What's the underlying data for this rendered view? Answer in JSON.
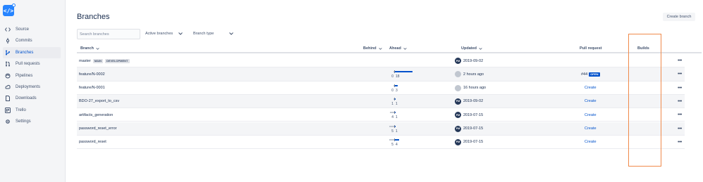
{
  "sidebar": {
    "logo": "</>",
    "items": [
      {
        "label": "Source",
        "icon": "code-icon"
      },
      {
        "label": "Commits",
        "icon": "commit-icon"
      },
      {
        "label": "Branches",
        "icon": "branch-icon"
      },
      {
        "label": "Pull requests",
        "icon": "pull-request-icon"
      },
      {
        "label": "Pipelines",
        "icon": "pipelines-icon"
      },
      {
        "label": "Deployments",
        "icon": "deployments-icon"
      },
      {
        "label": "Downloads",
        "icon": "downloads-icon"
      },
      {
        "label": "Trello",
        "icon": "trello-icon"
      },
      {
        "label": "Settings",
        "icon": "gear-icon"
      }
    ]
  },
  "header": {
    "title": "Branches",
    "create_button": "Create branch"
  },
  "filters": {
    "search_placeholder": "Search branches",
    "active": "Active branches",
    "type": "Branch type"
  },
  "table": {
    "columns": {
      "branch": "Branch",
      "behind": "Behind",
      "ahead": "Ahead",
      "updated": "Updated",
      "pull_request": "Pull request",
      "builds": "Builds"
    },
    "rows": [
      {
        "name": "master",
        "tags": [
          "MAIN",
          "DEVELOPMENT"
        ],
        "behind": null,
        "ahead": null,
        "behind_label": "",
        "ahead_label": "",
        "avatar": "PM",
        "avatar_default": false,
        "updated": "2019-09-02",
        "pr": ""
      },
      {
        "name": "feature/N-0002",
        "tags": [],
        "behind": 0,
        "ahead": 18,
        "behind_label": "0",
        "ahead_label": "18",
        "avatar": "",
        "avatar_default": true,
        "updated": "2 hours ago",
        "pr": "#44",
        "pr_status": "OPEN"
      },
      {
        "name": "feature/N-0001",
        "tags": [],
        "behind": 0,
        "ahead": 3,
        "behind_label": "0",
        "ahead_label": "3",
        "avatar": "",
        "avatar_default": true,
        "updated": "16 hours ago",
        "pr": "Create"
      },
      {
        "name": "BDO-27_export_to_csv",
        "tags": [],
        "behind": 1,
        "ahead": 1,
        "behind_label": "1",
        "ahead_label": "1",
        "avatar": "PM",
        "avatar_default": false,
        "updated": "2019-09-02",
        "pr": "Create"
      },
      {
        "name": "artifacts_generation",
        "tags": [],
        "behind": 4,
        "ahead": 1,
        "behind_label": "4",
        "ahead_label": "1",
        "avatar": "PM",
        "avatar_default": false,
        "updated": "2019-07-15",
        "pr": "Create"
      },
      {
        "name": "password_reset_error",
        "tags": [],
        "behind": 5,
        "ahead": 1,
        "behind_label": "5",
        "ahead_label": "1",
        "avatar": "PM",
        "avatar_default": false,
        "updated": "2019-07-15",
        "pr": "Create"
      },
      {
        "name": "password_reset",
        "tags": [],
        "behind": 5,
        "ahead": 4,
        "behind_label": "5",
        "ahead_label": "4",
        "avatar": "PM",
        "avatar_default": false,
        "updated": "2019-07-15",
        "pr": "Create"
      }
    ]
  },
  "colors": {
    "accent": "#0052cc",
    "highlight": "#f08a4b",
    "sidebar_bg": "#f4f5f7"
  }
}
